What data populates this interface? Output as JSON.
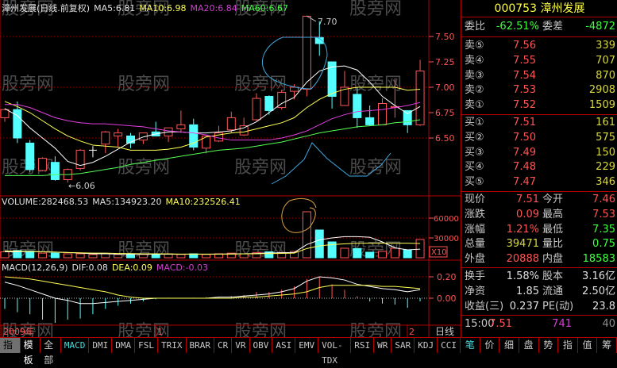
{
  "watermark": "股旁网",
  "header": {
    "title": "漳州发展(日线.前复权)",
    "ma5": "MA5:6.81",
    "ma10": "MA10:6.98",
    "ma20": "MA20:6.84",
    "ma60": "MA60:6.67"
  },
  "volume_header": {
    "volume": "VOLUME:282468.53",
    "ma5": "MA5:134923.20",
    "ma10": "MA10:232526.41"
  },
  "macd_header": {
    "name": "MACD(12,26,9)",
    "dif": "DIF:0.08",
    "dea": "DEA:0.09",
    "macd": "MACD:-0.03"
  },
  "annotations": {
    "high": "7.70",
    "low": "←6.06"
  },
  "axes": {
    "price_ticks": [
      "7.50",
      "7.25",
      "7.00",
      "6.75",
      "6.50"
    ],
    "volume_ticks": [
      "60000",
      "30000"
    ],
    "volume_multiplier": "X10",
    "macd_ticks": [
      "0.20",
      "0.00"
    ],
    "date_labels": [
      "2009年",
      "1",
      "2"
    ],
    "period": "日线"
  },
  "colors": {
    "up": "#ff5454",
    "down": "#54ffff",
    "ma5": "#ffffff",
    "ma10": "#ffff54",
    "ma20": "#e040e0",
    "ma60": "#54ff54",
    "grid": "#a00000",
    "axis": "#ff5454"
  },
  "chart_data": [
    {
      "type": "candlestick",
      "title": "漳州发展(日线.前复权)",
      "ylim": [
        6.0,
        7.75
      ],
      "ohlc": [
        [
          6.7,
          6.79,
          6.66,
          6.78
        ],
        [
          6.78,
          6.86,
          6.45,
          6.5
        ],
        [
          6.45,
          6.48,
          6.16,
          6.19
        ],
        [
          6.18,
          6.31,
          6.17,
          6.3
        ],
        [
          6.26,
          6.32,
          6.08,
          6.09
        ],
        [
          6.09,
          6.2,
          6.06,
          6.19
        ],
        [
          6.2,
          6.39,
          6.18,
          6.38
        ],
        [
          6.38,
          6.42,
          6.31,
          6.38
        ],
        [
          6.44,
          6.57,
          6.35,
          6.56
        ],
        [
          6.52,
          6.59,
          6.41,
          6.55
        ],
        [
          6.52,
          6.55,
          6.4,
          6.45
        ],
        [
          6.48,
          6.55,
          6.44,
          6.55
        ],
        [
          6.56,
          6.66,
          6.52,
          6.52
        ],
        [
          6.52,
          6.6,
          6.46,
          6.6
        ],
        [
          6.59,
          6.77,
          6.55,
          6.63
        ],
        [
          6.63,
          6.69,
          6.38,
          6.41
        ],
        [
          6.4,
          6.52,
          6.35,
          6.52
        ],
        [
          6.47,
          6.62,
          6.46,
          6.55
        ],
        [
          6.58,
          6.76,
          6.55,
          6.7
        ],
        [
          6.53,
          6.7,
          6.52,
          6.62
        ],
        [
          6.68,
          6.94,
          6.67,
          6.89
        ],
        [
          6.91,
          6.92,
          6.73,
          6.77
        ],
        [
          6.8,
          6.97,
          6.78,
          6.95
        ],
        [
          6.96,
          7.03,
          6.88,
          7.0
        ],
        [
          6.98,
          7.7,
          6.91,
          7.7
        ],
        [
          7.49,
          7.65,
          7.31,
          7.43
        ],
        [
          7.25,
          7.25,
          6.79,
          6.91
        ],
        [
          6.82,
          7.16,
          6.82,
          7.0
        ],
        [
          6.93,
          7.0,
          6.6,
          6.7
        ],
        [
          6.7,
          6.82,
          6.62,
          6.63
        ],
        [
          6.63,
          6.89,
          6.63,
          6.84
        ],
        [
          6.8,
          7.09,
          6.7,
          6.81
        ],
        [
          6.77,
          6.77,
          6.55,
          6.63
        ],
        [
          6.63,
          7.27,
          6.62,
          7.16
        ]
      ],
      "series": [
        {
          "name": "MA5",
          "values": [
            6.79,
            6.72,
            6.6,
            6.5,
            6.4,
            6.27,
            6.23,
            6.26,
            6.32,
            6.39,
            6.46,
            6.51,
            6.54,
            6.56,
            6.56,
            6.55,
            6.55,
            6.56,
            6.57,
            6.6,
            6.66,
            6.75,
            6.84,
            6.9,
            7.05,
            7.16,
            7.2,
            7.21,
            7.17,
            7.05,
            6.91,
            6.82,
            6.74,
            6.81
          ]
        },
        {
          "name": "MA10",
          "values": [
            6.86,
            6.81,
            6.75,
            6.67,
            6.59,
            6.52,
            6.47,
            6.43,
            6.42,
            6.41,
            6.38,
            6.38,
            6.38,
            6.39,
            6.41,
            6.45,
            6.51,
            6.53,
            6.55,
            6.56,
            6.59,
            6.62,
            6.65,
            6.7,
            6.8,
            6.88,
            6.94,
            6.98,
            7.0,
            7.0,
            7.0,
            7.0,
            6.97,
            6.98
          ]
        },
        {
          "name": "MA20",
          "values": [
            6.83,
            6.83,
            6.8,
            6.75,
            6.7,
            6.67,
            6.65,
            6.64,
            6.64,
            6.63,
            6.62,
            6.61,
            6.59,
            6.57,
            6.56,
            6.55,
            6.53,
            6.5,
            6.48,
            6.48,
            6.48,
            6.48,
            6.5,
            6.53,
            6.57,
            6.63,
            6.69,
            6.73,
            6.76,
            6.77,
            6.78,
            6.8,
            6.82,
            6.85
          ]
        },
        {
          "name": "MA60",
          "values": [
            6.13,
            6.13,
            6.13,
            6.13,
            6.14,
            6.14,
            6.15,
            6.17,
            6.19,
            6.21,
            6.24,
            6.26,
            6.28,
            6.3,
            6.32,
            6.34,
            6.36,
            6.38,
            6.39,
            6.4,
            6.42,
            6.44,
            6.46,
            6.49,
            6.52,
            6.55,
            6.57,
            6.59,
            6.61,
            6.62,
            6.63,
            6.65,
            6.66,
            6.68
          ]
        }
      ]
    },
    {
      "type": "bar",
      "title": "VOLUME",
      "ylim": [
        0,
        90000
      ],
      "values": [
        9000,
        11000,
        10000,
        7000,
        7000,
        6000,
        6000,
        5000,
        6000,
        5000,
        6000,
        5000,
        5000,
        6000,
        5000,
        6000,
        5000,
        6000,
        7000,
        6000,
        8000,
        9000,
        8000,
        9500,
        69600,
        42000,
        24000,
        14400,
        14000,
        8400,
        9600,
        14400,
        12000,
        27600
      ],
      "series": [
        {
          "name": "MA5",
          "values": [
            9000,
            9000,
            9500,
            9000,
            8500,
            8000,
            7000,
            6000,
            6000,
            5600,
            5600,
            5400,
            5400,
            5400,
            5400,
            5600,
            5400,
            5600,
            5800,
            6000,
            6400,
            7200,
            7600,
            8000,
            20000,
            27000,
            30000,
            32000,
            32000,
            31000,
            24000,
            15000,
            12000,
            13000
          ]
        },
        {
          "name": "MA10",
          "values": [
            10000,
            10000,
            9500,
            9000,
            8500,
            8000,
            7500,
            7000,
            7000,
            6500,
            6300,
            6000,
            6000,
            5800,
            5600,
            5500,
            5500,
            5500,
            5600,
            5800,
            6000,
            6300,
            6600,
            7000,
            14000,
            18000,
            20000,
            21000,
            22000,
            22000,
            22000,
            22000,
            22000,
            21600
          ]
        }
      ]
    },
    {
      "type": "bar",
      "title": "MACD(12,26,9)",
      "ylim": [
        -0.25,
        0.25
      ],
      "values": [
        -0.1,
        -0.13,
        -0.15,
        -0.2,
        -0.23,
        -0.2,
        -0.19,
        -0.15,
        -0.1,
        -0.07,
        -0.05,
        -0.03,
        -0.01,
        0.005,
        0,
        0.005,
        0.01,
        0.01,
        0.02,
        0.03,
        0.06,
        0.06,
        0.08,
        0.11,
        0.18,
        0.2,
        0.13,
        0.08,
        0.02,
        -0.03,
        -0.05,
        -0.06,
        -0.09,
        -0.03
      ],
      "series": [
        {
          "name": "DIF",
          "values": [
            0.15,
            0.12,
            0.08,
            0.04,
            0.0,
            -0.02,
            -0.05,
            -0.05,
            -0.04,
            -0.03,
            -0.02,
            -0.01,
            0,
            0,
            0,
            0,
            0,
            0.01,
            0.01,
            0.02,
            0.03,
            0.04,
            0.06,
            0.09,
            0.16,
            0.2,
            0.19,
            0.17,
            0.13,
            0.11,
            0.09,
            0.08,
            0.06,
            0.08
          ]
        },
        {
          "name": "DEA",
          "values": [
            0.2,
            0.19,
            0.18,
            0.16,
            0.14,
            0.12,
            0.1,
            0.08,
            0.06,
            0.03,
            0.01,
            0,
            0,
            0,
            0,
            0,
            0,
            0,
            0,
            0.01,
            0.01,
            0.02,
            0.03,
            0.04,
            0.06,
            0.1,
            0.12,
            0.12,
            0.12,
            0.12,
            0.11,
            0.11,
            0.1,
            0.09
          ]
        }
      ]
    }
  ],
  "quote": {
    "code": "000753",
    "name": "漳州发展",
    "wb_label": "委比",
    "wb_value": "-62.51%",
    "wc_label": "委差",
    "wc_value": "-4872",
    "sell": [
      {
        "label": "卖⑤",
        "price": "7.56",
        "vol": "339"
      },
      {
        "label": "卖④",
        "price": "7.55",
        "vol": "707"
      },
      {
        "label": "卖③",
        "price": "7.54",
        "vol": "870"
      },
      {
        "label": "卖②",
        "price": "7.53",
        "vol": "2908"
      },
      {
        "label": "卖①",
        "price": "7.52",
        "vol": "1509"
      }
    ],
    "buy": [
      {
        "label": "买①",
        "price": "7.51",
        "vol": "161"
      },
      {
        "label": "买②",
        "price": "7.50",
        "vol": "575"
      },
      {
        "label": "买③",
        "price": "7.49",
        "vol": "150"
      },
      {
        "label": "买④",
        "price": "7.48",
        "vol": "229"
      },
      {
        "label": "买⑤",
        "price": "7.47",
        "vol": "346"
      }
    ],
    "stats": [
      {
        "l": "现价",
        "v": "7.51",
        "l2": "今开",
        "v2": "7.46"
      },
      {
        "l": "涨跌",
        "v": "0.09",
        "l2": "最高",
        "v2": "7.53"
      },
      {
        "l": "涨幅",
        "v": "1.21%",
        "l2": "最低",
        "v2": "7.35"
      },
      {
        "l": "总量",
        "v": "39471",
        "l2": "量比",
        "v2": "0.75"
      },
      {
        "l": "外盘",
        "v": "20888",
        "l2": "内盘",
        "v2": "18583"
      }
    ],
    "fund": [
      {
        "l": "换手",
        "v": "1.58%",
        "l2": "股本",
        "v2": "3.16亿"
      },
      {
        "l": "净资",
        "v": "1.85",
        "l2": "流通",
        "v2": "2.50亿"
      },
      {
        "l": "收益(三)",
        "v": "0.237",
        "l2": "PE(动)",
        "v2": "23.8"
      }
    ],
    "tick": {
      "time": "15:00",
      "price": "7.51",
      "vol": "741",
      "count": "40"
    }
  },
  "bottom_tabs": [
    "指标",
    "模板",
    "全部",
    "MACD",
    "DMI",
    "DMA",
    "FSL",
    "TRIX",
    "BRAR",
    "CR",
    "VR",
    "OBV",
    "ASI",
    "EMV",
    "VOL-TDX",
    "RSI",
    "WR",
    "SAR",
    "KDJ",
    "CCI"
  ],
  "right_tabs": [
    "笔",
    "价",
    "细",
    "盘",
    "势",
    "指",
    "值",
    "筹"
  ]
}
